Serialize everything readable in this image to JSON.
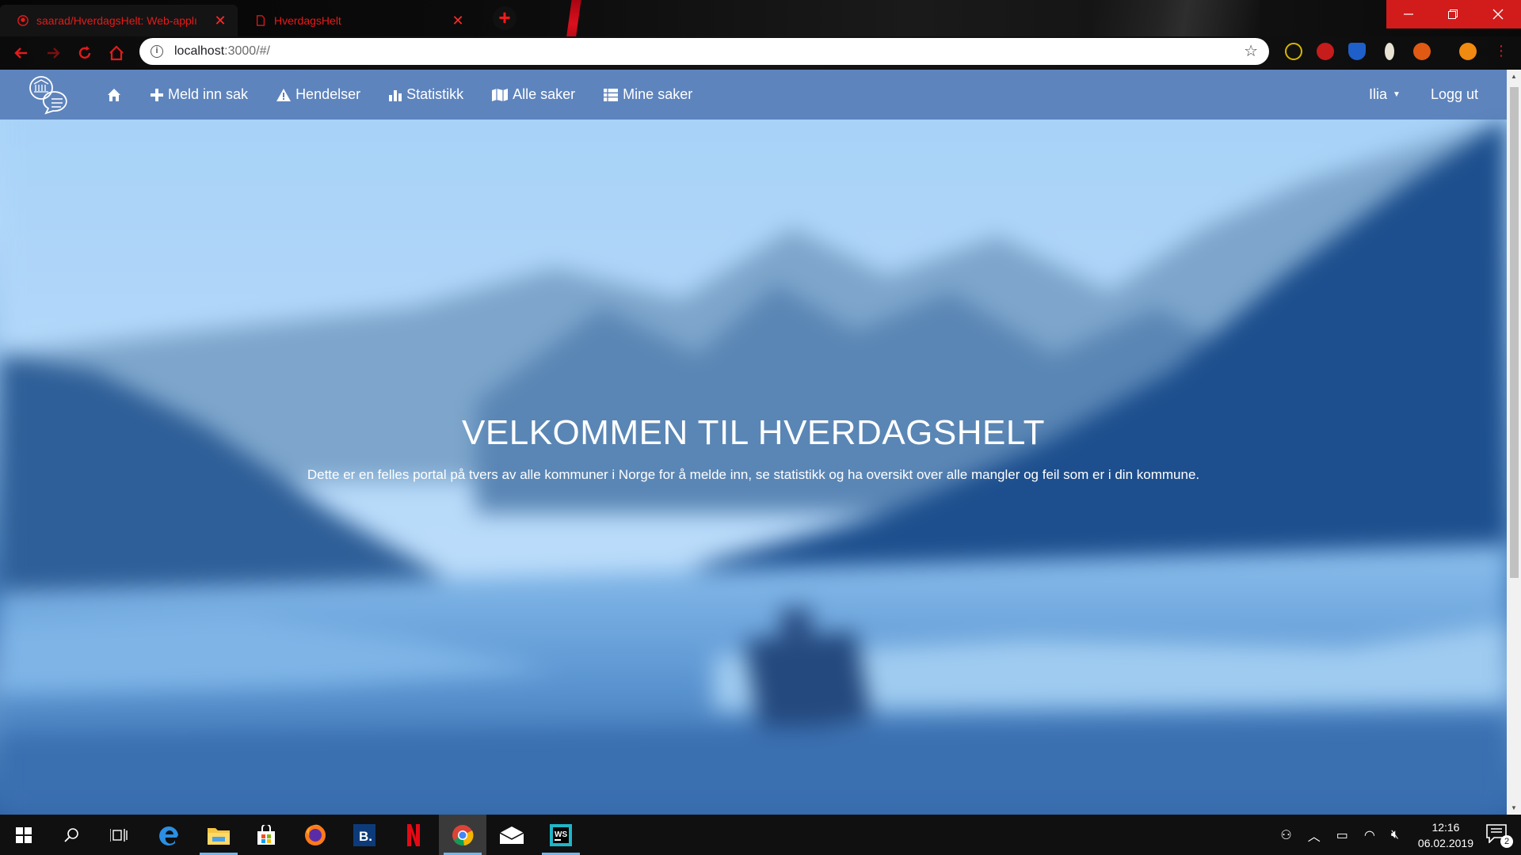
{
  "browser": {
    "tabs": [
      {
        "title": "saarad/HverdagsHelt: Web-applı",
        "active": true
      },
      {
        "title": "HverdagsHelt",
        "active": false
      }
    ],
    "new_tab_label": "+",
    "url_host": "localhost",
    "url_rest": ":3000/#/",
    "accent_color": "#e51a1a"
  },
  "site": {
    "nav": {
      "home_icon": "home-icon",
      "links": [
        {
          "label": "Meld inn sak",
          "icon": "plus-icon"
        },
        {
          "label": "Hendelser",
          "icon": "warning-icon"
        },
        {
          "label": "Statistikk",
          "icon": "bar-chart-icon"
        },
        {
          "label": "Alle saker",
          "icon": "map-icon"
        },
        {
          "label": "Mine saker",
          "icon": "list-icon"
        }
      ],
      "user": "Ilia",
      "logout": "Logg ut"
    },
    "hero": {
      "title": "VELKOMMEN TIL HVERDAGSHELT",
      "subtitle": "Dette er en felles portal på tvers av alle kommuner i Norge for å melde inn, se statistikk og ha oversikt over alle mangler og feil som er i din kommune."
    }
  },
  "taskbar": {
    "time": "12:16",
    "date": "06.02.2019",
    "notifications": "2"
  }
}
